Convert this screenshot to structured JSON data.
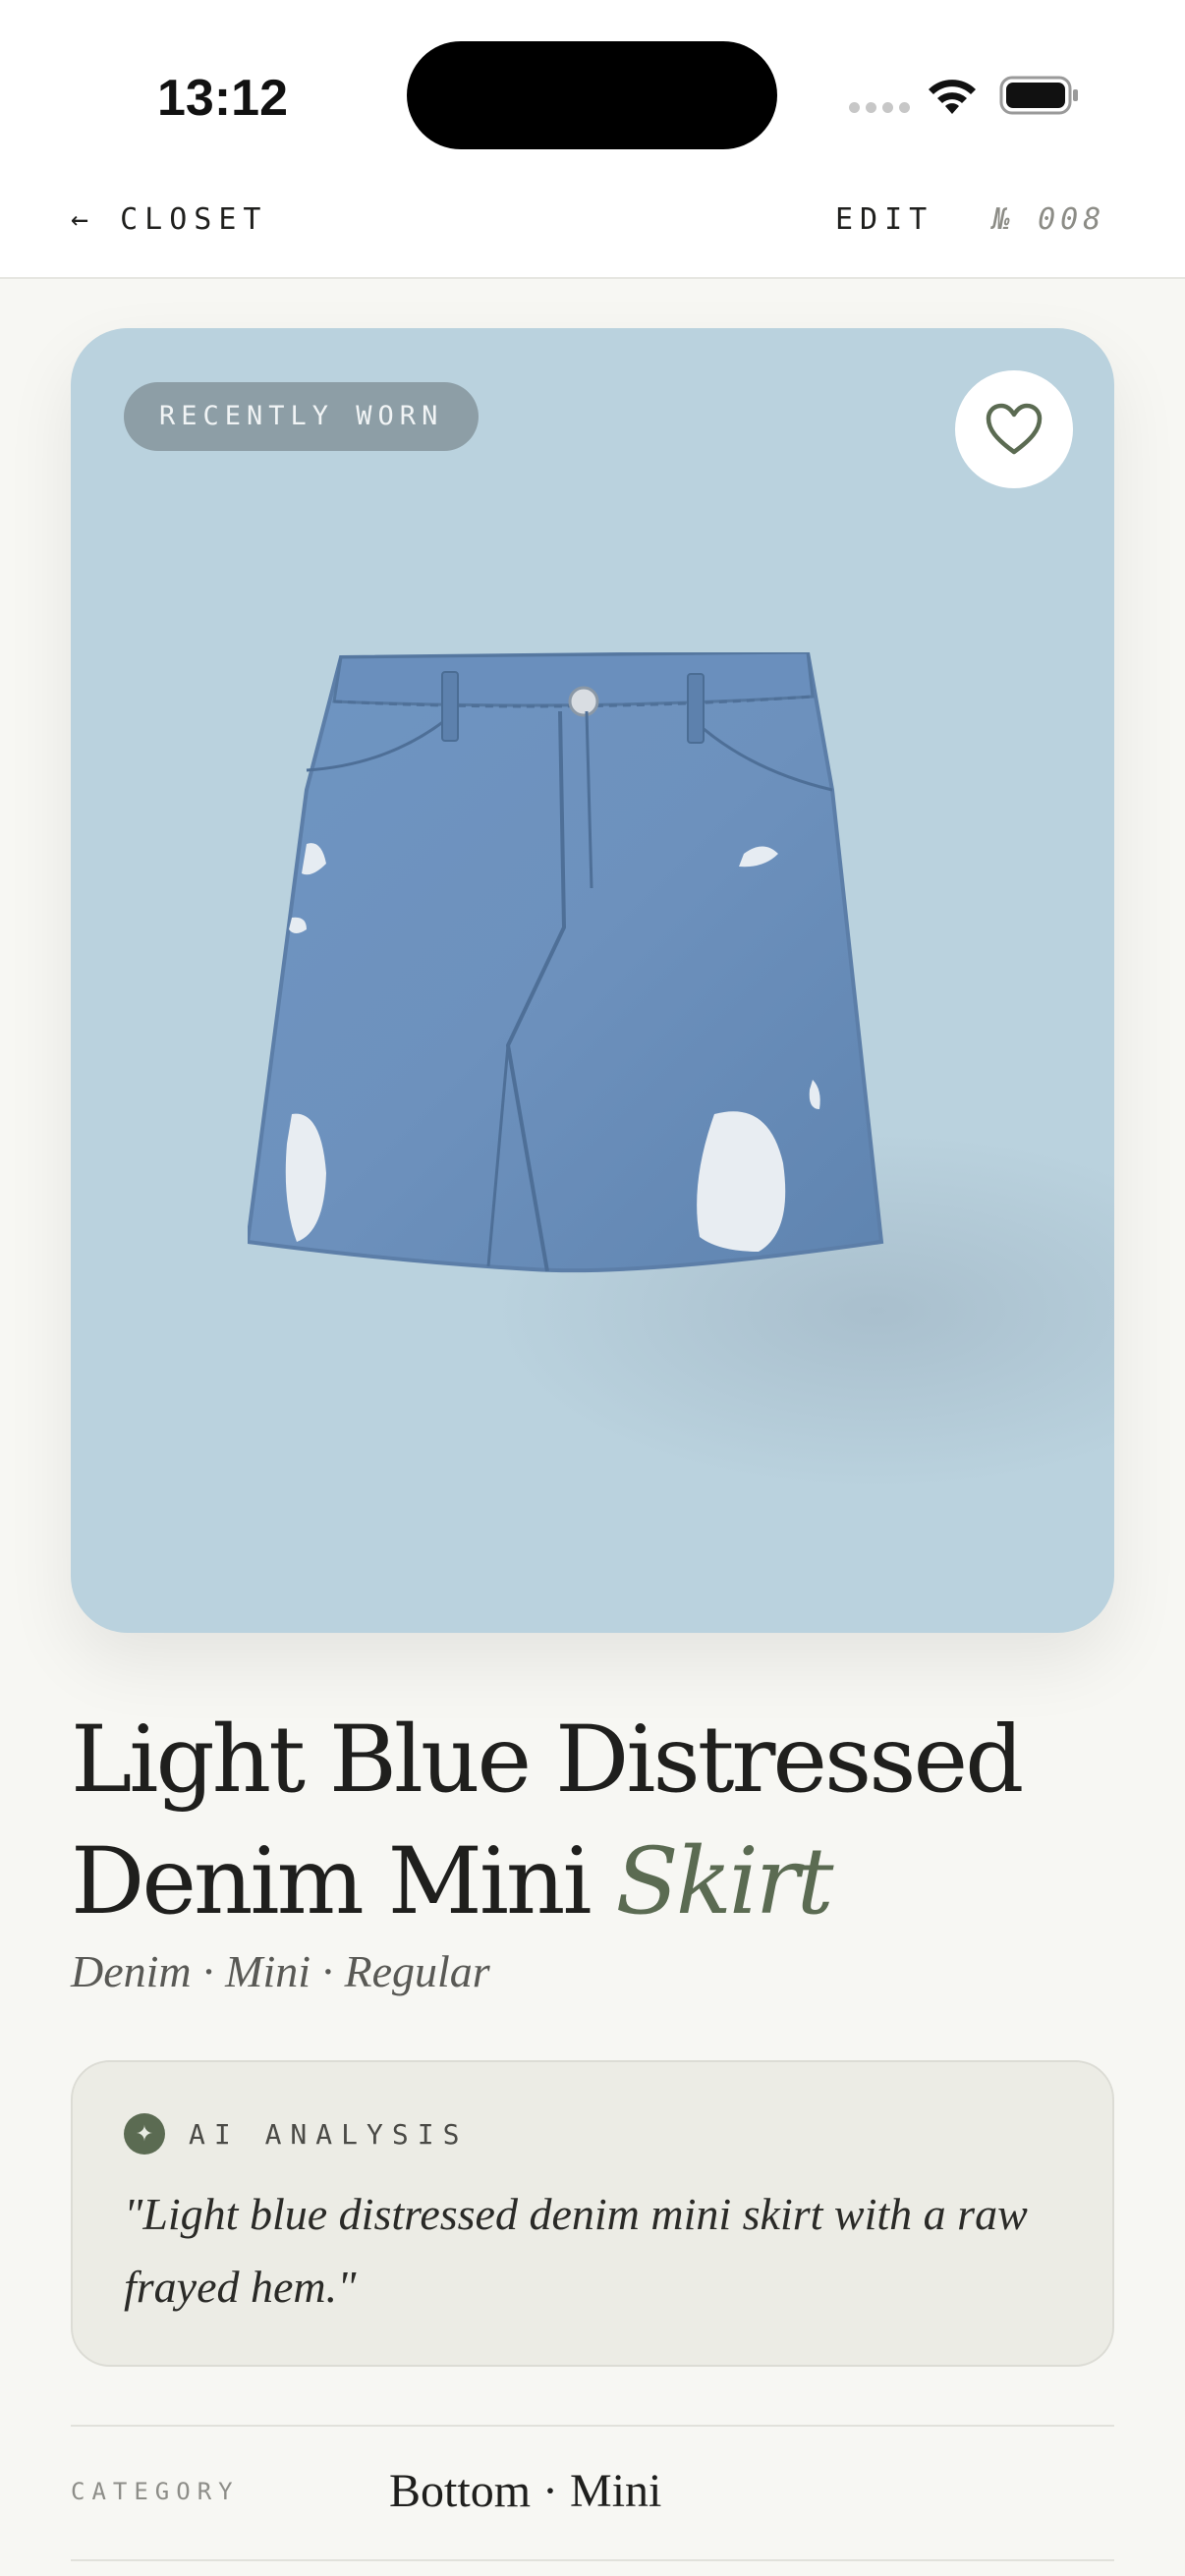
{
  "status_bar": {
    "time": "13:12",
    "icons": [
      "signal-dots-icon",
      "wifi-icon",
      "battery-icon"
    ]
  },
  "nav": {
    "back_label": "← CLOSET",
    "edit_label": "EDIT",
    "item_number": "№ 008"
  },
  "item": {
    "badge": "RECENTLY WORN",
    "favorite_icon": "heart-icon",
    "image_description": "denim-skirt-photo",
    "title_main": "Light Blue Distressed Denim Mini ",
    "title_accent": "Skirt",
    "subtitle": "Denim · Mini · Regular"
  },
  "ai_analysis": {
    "icon": "sparkle-icon",
    "label": "AI ANALYSIS",
    "quote": "\"Light blue distressed denim mini skirt with a raw frayed hem.\""
  },
  "details": [
    {
      "label": "CATEGORY",
      "value": "Bottom · Mini"
    }
  ],
  "colors": {
    "background": "#f7f7f3",
    "photo_background": "#bad2de",
    "accent": "#5b6b52",
    "ai_card": "#ecece5"
  }
}
